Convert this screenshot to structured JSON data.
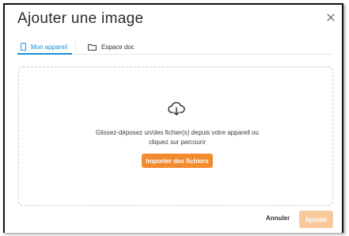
{
  "dialog": {
    "title": "Ajouter une image",
    "close_icon": "close-icon"
  },
  "tabs": [
    {
      "label": "Mon appareil",
      "icon": "mobile-device-icon",
      "active": true
    },
    {
      "label": "Espace doc",
      "icon": "folder-icon",
      "active": false
    }
  ],
  "dropzone": {
    "icon": "cloud-upload-icon",
    "text_line1": "Glissez-déposez un/des fichier(s) depuis votre appareil ou",
    "text_line2": "cliquez sur parcourir",
    "import_label": "Importer des fichiers"
  },
  "footer": {
    "cancel_label": "Annuler",
    "add_label": "Ajouter",
    "add_disabled": true
  },
  "colors": {
    "accent_blue": "#1a90d6",
    "primary_orange": "#f28b2e",
    "disabled_orange": "#f8c99a"
  }
}
